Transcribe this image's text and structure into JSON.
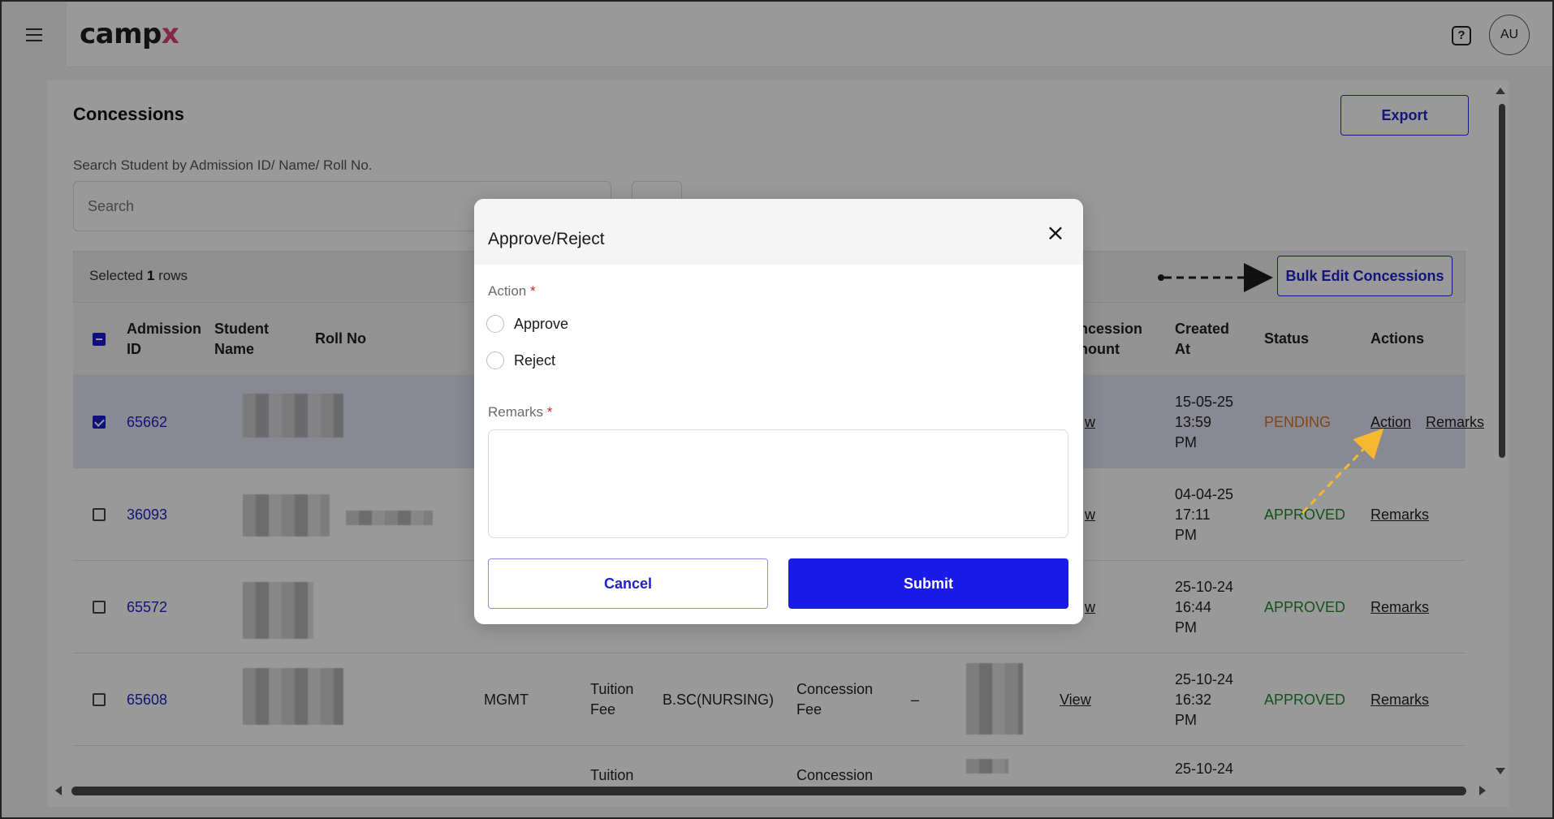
{
  "app": {
    "logo_main": "camp",
    "logo_accent": "x",
    "help_icon_glyph": "?",
    "avatar_initials": "AU"
  },
  "page": {
    "title": "Concessions",
    "export_label": "Export",
    "search_label": "Search Student by Admission ID/ Name/ Roll No.",
    "search_placeholder": "Search",
    "selected_prefix": "Selected",
    "selected_count": "1",
    "selected_suffix": "rows",
    "bulk_edit_label": "Bulk Edit Concessions"
  },
  "table": {
    "headers": {
      "admission_id": [
        "Admission",
        "ID"
      ],
      "student_name": [
        "Student",
        "Name"
      ],
      "roll_no": "Roll No",
      "concession_amount": [
        "ncession",
        "nount"
      ],
      "created_at": [
        "Created",
        "At"
      ],
      "status": "Status",
      "actions": "Actions"
    },
    "rows": [
      {
        "id": "65662",
        "partial_view": "w",
        "created": [
          "15-05-25",
          "13:59",
          "PM"
        ],
        "status": "PENDING",
        "action": "Action",
        "remarks": "Remarks"
      },
      {
        "id": "36093",
        "partial_view": "w",
        "created": [
          "04-04-25",
          "17:11",
          "PM"
        ],
        "status": "APPROVED",
        "remarks": "Remarks"
      },
      {
        "id": "65572",
        "partial_view": "w",
        "created": [
          "25-10-24",
          "16:44",
          "PM"
        ],
        "status": "APPROVED",
        "remarks": "Remarks"
      },
      {
        "id": "65608",
        "quota": "MGMT",
        "fee_type": [
          "Tuition",
          "Fee"
        ],
        "program": "B.SC(NURSING)",
        "concession_type": [
          "Concession",
          "Fee"
        ],
        "dash": "–",
        "view": "View",
        "created": [
          "25-10-24",
          "16:32",
          "PM"
        ],
        "status": "APPROVED",
        "remarks": "Remarks"
      },
      {
        "fee_type_partial": "Tuition",
        "concession_partial": "Concession",
        "created_partial": "25-10-24"
      }
    ]
  },
  "modal": {
    "title": "Approve/Reject",
    "close_glyph": "×",
    "action_label": "Action",
    "required_mark": "*",
    "options": [
      "Approve",
      "Reject"
    ],
    "remarks_label": "Remarks",
    "cancel_label": "Cancel",
    "submit_label": "Submit"
  },
  "colors": {
    "brand_accent": "#e0407a",
    "primary": "#1a1aeb",
    "link": "#1e1ec8",
    "pending": "#e0731c",
    "approved": "#1f8a2a",
    "annotation_arrow": "#f5b830"
  }
}
